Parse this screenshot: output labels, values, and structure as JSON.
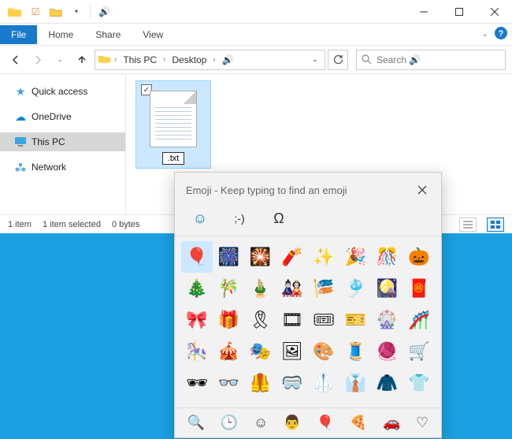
{
  "titlebar": {
    "title": "🔊"
  },
  "ribbon": {
    "file": "File",
    "tabs": [
      "Home",
      "Share",
      "View"
    ]
  },
  "breadcrumb": {
    "segments": [
      "This PC",
      "Desktop",
      "🔊"
    ]
  },
  "search_placeholder": "Search 🔊",
  "sidebar": {
    "items": [
      {
        "label": "Quick access",
        "icon": "★",
        "color": "#3aa0e8"
      },
      {
        "label": "OneDrive",
        "icon": "☁",
        "color": "#0a84d6"
      },
      {
        "label": "This PC",
        "icon": "💻",
        "color": "#2a8ad4",
        "selected": true
      },
      {
        "label": "Network",
        "icon": "🌐",
        "color": "#4aa6e0"
      }
    ]
  },
  "file": {
    "name": ".txt"
  },
  "status": {
    "count": "1 item",
    "selected": "1 item selected",
    "size": "0 bytes"
  },
  "emoji": {
    "title": "Emoji - Keep typing to find an emoji",
    "tabs": [
      "☺",
      ";-)",
      "Ω"
    ],
    "grid": [
      "🎈",
      "🎆",
      "🎇",
      "🧨",
      "✨",
      "🎉",
      "🎊",
      "🎃",
      "🎄",
      "🎋",
      "🎍",
      "🎎",
      "🎏",
      "🎐",
      "🎑",
      "🧧",
      "🎀",
      "🎁",
      "🎗",
      "🎞",
      "🎟",
      "🎫",
      "🎡",
      "🎢",
      "🎠",
      "🎪",
      "🎭",
      "🖼",
      "🎨",
      "🧵",
      "🧶",
      "🛒",
      "🕶",
      "👓",
      "🦺",
      "🥽",
      "🥼",
      "👔",
      "🧥",
      "👕"
    ],
    "cats": [
      "🔍",
      "🕒",
      "☺",
      "👨",
      "🎈",
      "🍕",
      "🚗",
      "♡"
    ]
  }
}
